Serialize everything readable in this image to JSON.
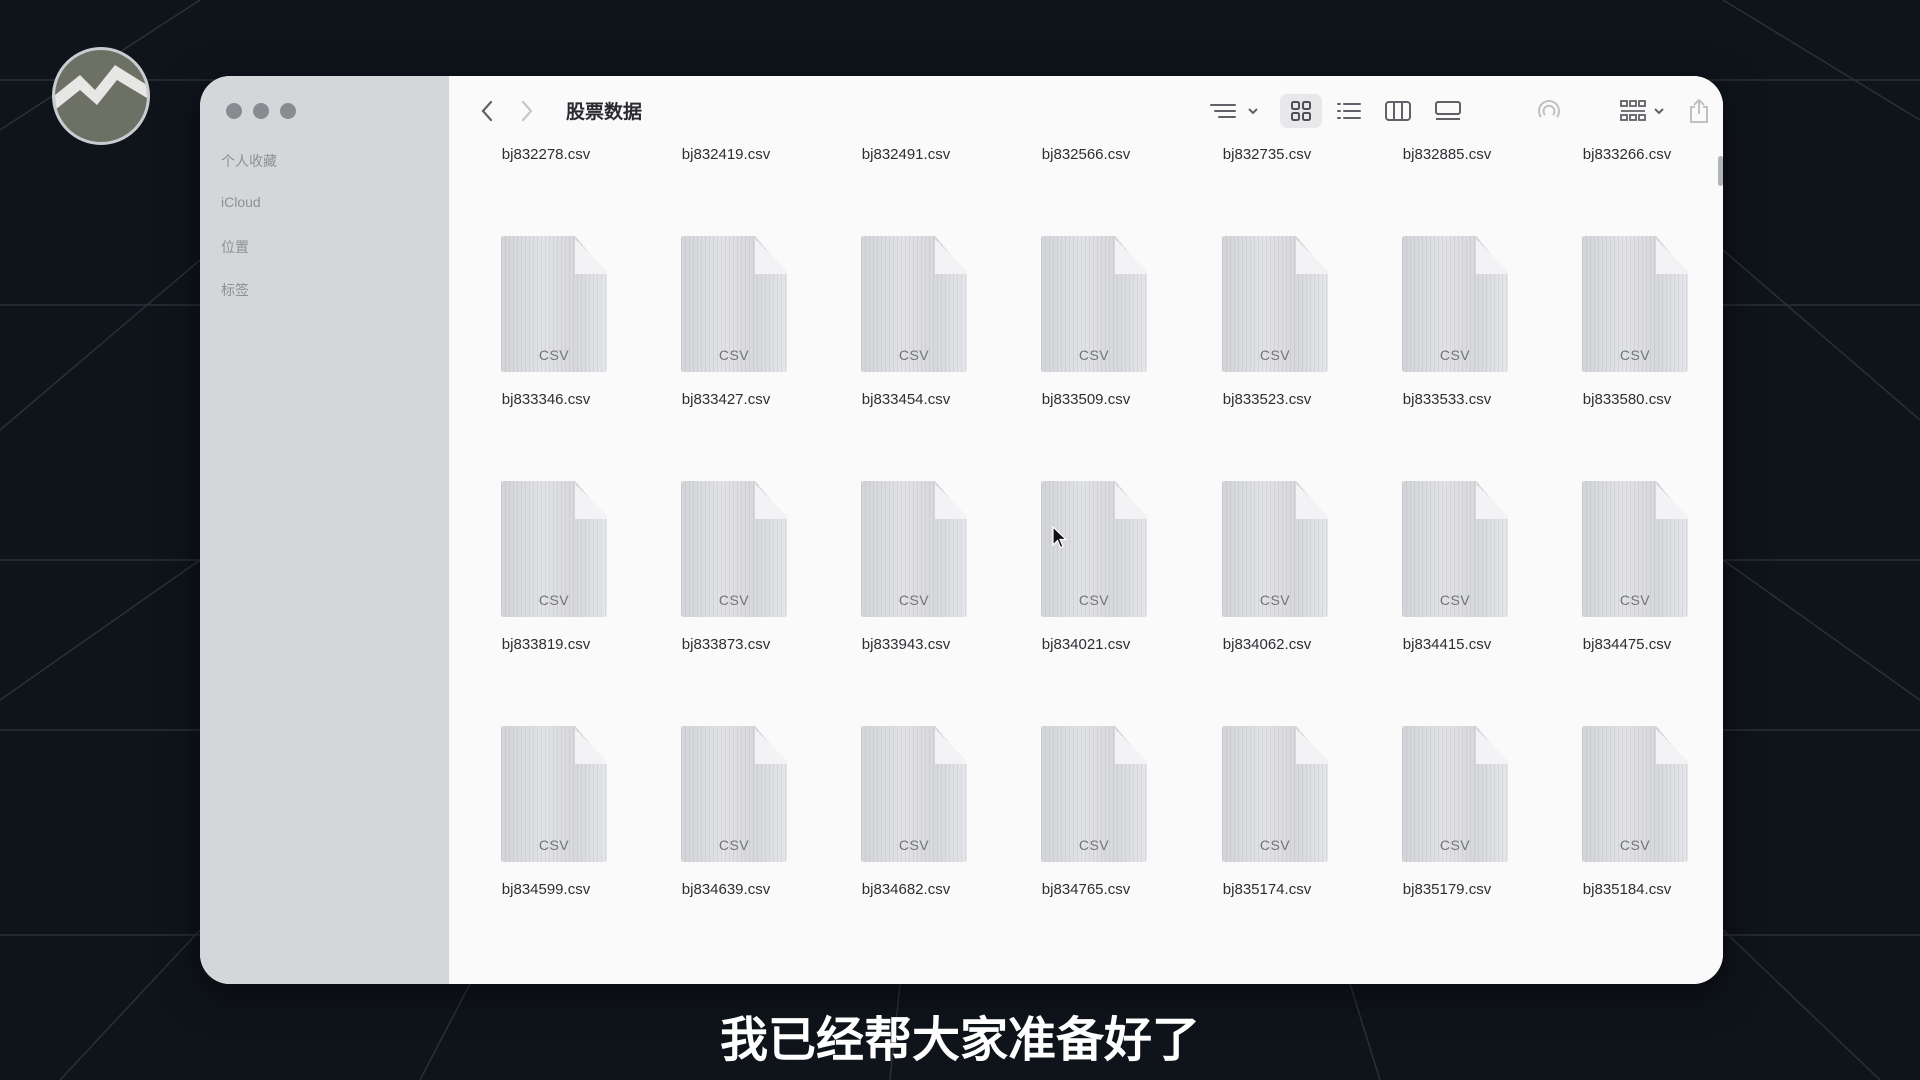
{
  "window": {
    "title": "股票数据",
    "toolbar_icons": [
      "chevron-left-icon",
      "chevron-right-icon",
      "sort-icon",
      "icon-view-icon",
      "list-view-icon",
      "column-view-icon",
      "gallery-view-icon",
      "airdrop-icon",
      "group-icon",
      "share-icon",
      "more-icon",
      "search-icon"
    ]
  },
  "sidebar": {
    "items": [
      {
        "label": "个人收藏"
      },
      {
        "label": "iCloud"
      },
      {
        "label": "位置"
      },
      {
        "label": "标签"
      }
    ]
  },
  "file_type_label": "CSV",
  "files": [
    [
      "bj832278.csv",
      "bj832419.csv",
      "bj832491.csv",
      "bj832566.csv",
      "bj832735.csv",
      "bj832885.csv",
      "bj833266.csv"
    ],
    [
      "bj833346.csv",
      "bj833427.csv",
      "bj833454.csv",
      "bj833509.csv",
      "bj833523.csv",
      "bj833533.csv",
      "bj833580.csv"
    ],
    [
      "bj833819.csv",
      "bj833873.csv",
      "bj833943.csv",
      "bj834021.csv",
      "bj834062.csv",
      "bj834415.csv",
      "bj834475.csv"
    ],
    [
      "bj834599.csv",
      "bj834639.csv",
      "bj834682.csv",
      "bj834765.csv",
      "bj835174.csv",
      "bj835179.csv",
      "bj835184.csv"
    ]
  ],
  "caption": "我已经帮大家准备好了"
}
